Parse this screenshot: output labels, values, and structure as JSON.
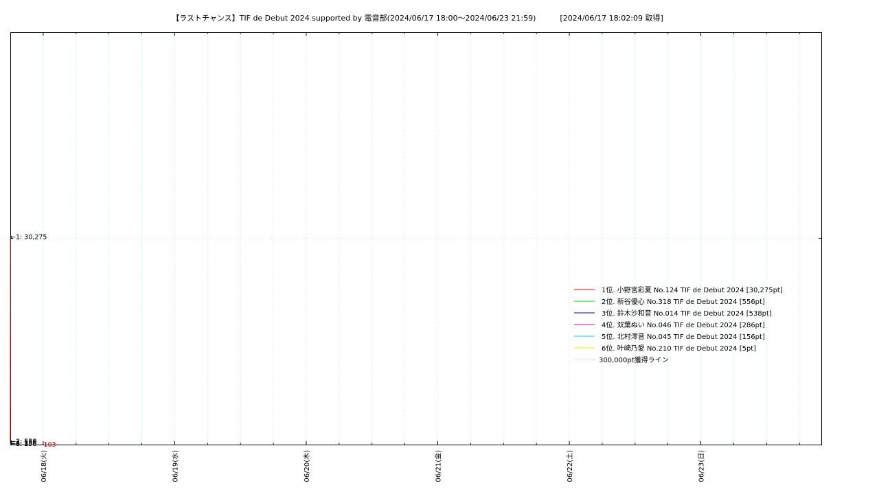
{
  "chart_data": {
    "type": "line",
    "title": "【ラストチャンス】TIF de Debut 2024 supported by 電音部(2024/06/17 18:00～2024/06/23 21:59)",
    "fetched": "[2024/06/17 18:02:09 取得]",
    "xlabel": "",
    "ylabel": "",
    "x_start": "2024-06-17T18:00",
    "x_end": "2024-06-23T21:59",
    "ylim": [
      0,
      60000
    ],
    "grid": true,
    "legend_placement": "center-right",
    "x_ticks": [
      {
        "date": "2024-06-18",
        "label": "06/18(火)"
      },
      {
        "date": "2024-06-19",
        "label": "06/19(水)"
      },
      {
        "date": "2024-06-20",
        "label": "06/20(木)"
      },
      {
        "date": "2024-06-21",
        "label": "06/21(金)"
      },
      {
        "date": "2024-06-22",
        "label": "06/22(土)"
      },
      {
        "date": "2024-06-23",
        "label": "06/23(日)"
      }
    ],
    "series": [
      {
        "name": "1位. 小野宮彩夏 No.124 TIF de Debut 2024 [30,275pt]",
        "color": "#ff0000",
        "x": [
          "2024-06-17T18:00",
          "2024-06-17T18:02"
        ],
        "values": [
          0,
          30275
        ],
        "annotation": "←1: 30,275"
      },
      {
        "name": "2位. 新谷優心 No.318 TIF de Debut 2024 [556pt]",
        "color": "#00dd00",
        "x": [
          "2024-06-17T18:00",
          "2024-06-17T18:02"
        ],
        "values": [
          0,
          556
        ],
        "annotation": "←2: 556"
      },
      {
        "name": "3位. 鈴木沙和音 No.014 TIF de Debut 2024 [538pt]",
        "color": "#0000aa",
        "x": [
          "2024-06-17T18:00",
          "2024-06-17T18:02"
        ],
        "values": [
          0,
          538
        ],
        "annotation": "←3: 538"
      },
      {
        "name": "4位. 双葉ぬい No.046 TIF de Debut 2024 [286pt]",
        "color": "#dd00dd",
        "x": [
          "2024-06-17T18:00",
          "2024-06-17T18:02"
        ],
        "values": [
          0,
          286
        ],
        "annotation": "←4: 286"
      },
      {
        "name": "5位. 北村澪音 No.045 TIF de Debut 2024 [156pt]",
        "color": "#00dddd",
        "x": [
          "2024-06-17T18:00",
          "2024-06-17T18:02"
        ],
        "values": [
          0,
          156
        ],
        "annotation": "←5: 156"
      },
      {
        "name": "6位. 叶崎乃愛 No.210 TIF de Debut 2024 [5pt]",
        "color": "#eeee00",
        "x": [
          "2024-06-17T18:00",
          "2024-06-17T18:02"
        ],
        "values": [
          0,
          5
        ],
        "annotation": "←6: 5"
      }
    ],
    "difference_label": "-103",
    "reference_line": {
      "name": "300,000pt獲得ライン",
      "value": 300000,
      "color": "#ff9999"
    },
    "colors": {
      "grid_vertical": "#a8e8d0",
      "grid_horizontal": "#b8ece4",
      "difference_label": "#cc0000",
      "frame": "#000000"
    }
  }
}
